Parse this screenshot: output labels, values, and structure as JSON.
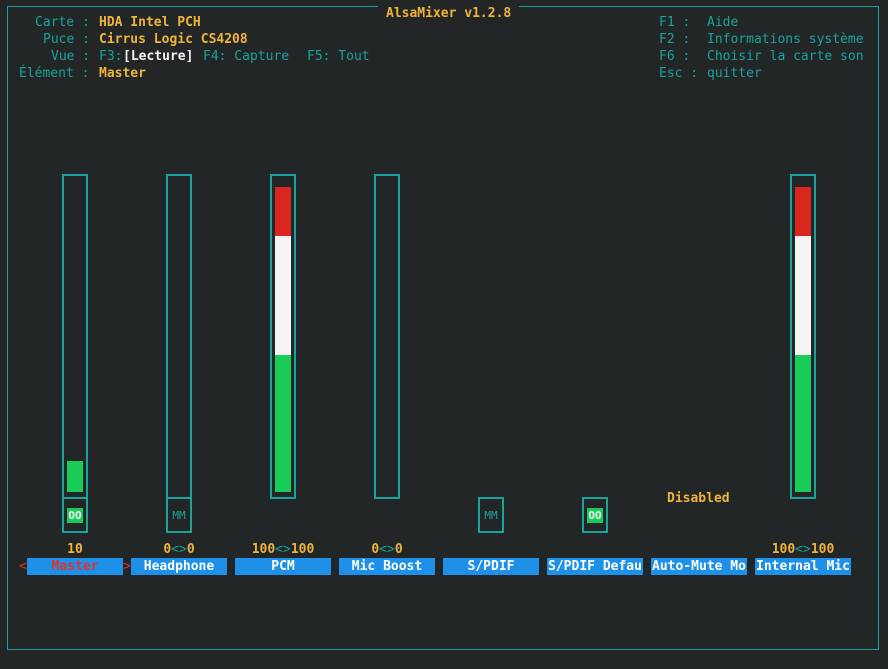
{
  "app": {
    "title": "AlsaMixer v1.2.8"
  },
  "info": {
    "card_label": "Carte :",
    "card_value": "HDA Intel PCH",
    "chip_label": "Puce :",
    "chip_value": "Cirrus Logic CS4208",
    "view_label": "Vue :",
    "view_f3_key": "F3:",
    "view_f3_value": "[Lecture]",
    "view_f4": "F4: Capture",
    "view_f5": "F5: Tout",
    "element_label": "Élément :",
    "element_value": "Master"
  },
  "help": {
    "f1_key": "F1 :",
    "f1_text": "Aide",
    "f2_key": "F2 :",
    "f2_text": "Informations système",
    "f6_key": "F6 :",
    "f6_text": "Choisir la carte son",
    "esc_key": "Esc :",
    "esc_text": "quitter"
  },
  "channels": [
    {
      "name": "Master",
      "value_left": "10",
      "switch": "OO",
      "level": 0.1
    },
    {
      "name": "Headphone",
      "value_left": "0",
      "sep": "<>",
      "value_right": "0",
      "switch": "MM",
      "level": 0
    },
    {
      "name": "PCM",
      "value_left": "100",
      "sep": "<>",
      "value_right": "100",
      "level": 1.0
    },
    {
      "name": "Mic Boost",
      "value_left": "0",
      "sep": "<>",
      "value_right": "0",
      "level": 0
    },
    {
      "name": "S/PDIF",
      "switch": "MM"
    },
    {
      "name": "S/PDIF Defau",
      "switch": "OO"
    },
    {
      "name": "Auto-Mute Mo",
      "status": "Disabled"
    },
    {
      "name": "Internal Mic",
      "value_left": "100",
      "sep": "<>",
      "value_right": "100",
      "level": 1.0
    }
  ],
  "selection": {
    "left_arrow": "<",
    "right_arrow": ">"
  },
  "colors": {
    "background": "#222626",
    "frame": "#1aa39a",
    "accent": "#f0b43c",
    "label_bar": "#1e90e8",
    "meter_green": "#19cc57",
    "meter_white": "#f4f4f4",
    "meter_red": "#d9261f",
    "selected": "#e0332a"
  }
}
